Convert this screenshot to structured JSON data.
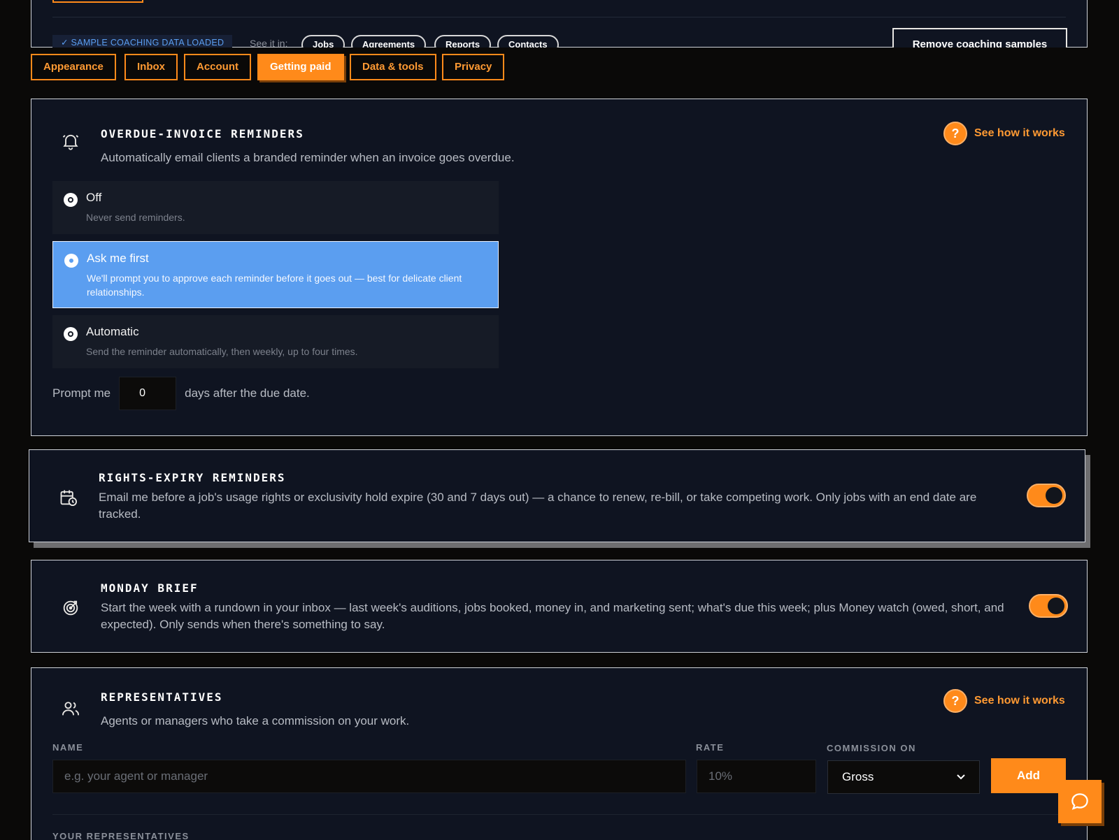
{
  "coaching": {
    "badge": "✓ SAMPLE COACHING DATA LOADED",
    "see_it_in": "See it in:",
    "links": [
      "Jobs",
      "Agreements",
      "Reports",
      "Contacts"
    ],
    "remove_label": "Remove coaching samples"
  },
  "tabs": [
    {
      "label": "Appearance",
      "active": false
    },
    {
      "label": "Inbox",
      "active": false
    },
    {
      "label": "Account",
      "active": false
    },
    {
      "label": "Getting paid",
      "active": true
    },
    {
      "label": "Data & tools",
      "active": false
    },
    {
      "label": "Privacy",
      "active": false
    }
  ],
  "overdue": {
    "icon": "bell-icon",
    "title": "OVERDUE-INVOICE REMINDERS",
    "description": "Automatically email clients a branded reminder when an invoice goes overdue.",
    "help": "See how it works",
    "options": [
      {
        "title": "Off",
        "desc": "Never send reminders.",
        "selected": false
      },
      {
        "title": "Ask me first",
        "desc": "We'll prompt you to approve each reminder before it goes out — best for delicate client relationships.",
        "selected": true
      },
      {
        "title": "Automatic",
        "desc": "Send the reminder automatically, then weekly, up to four times.",
        "selected": false
      }
    ],
    "prompt_prefix": "Prompt me",
    "prompt_days": "0",
    "prompt_suffix": "days after the due date."
  },
  "rights": {
    "icon": "calendar-clock-icon",
    "title": "RIGHTS-EXPIRY REMINDERS",
    "description": "Email me before a job's usage rights or exclusivity hold expire (30 and 7 days out) — a chance to renew, re-bill, or take competing work. Only jobs with an end date are tracked.",
    "enabled": true
  },
  "monday": {
    "icon": "target-icon",
    "title": "MONDAY BRIEF",
    "description": "Start the week with a rundown in your inbox — last week's auditions, jobs booked, money in, and marketing sent; what's due this week; plus Money watch (owed, short, and expected). Only sends when there's something to say.",
    "enabled": true
  },
  "reps": {
    "icon": "users-icon",
    "title": "REPRESENTATIVES",
    "description": "Agents or managers who take a commission on your work.",
    "help": "See how it works",
    "name_label": "NAME",
    "name_placeholder": "e.g. your agent or manager",
    "rate_label": "RATE",
    "rate_placeholder": "10%",
    "commission_label": "COMMISSION ON",
    "commission_value": "Gross",
    "add_label": "Add",
    "list_label": "YOUR REPRESENTATIVES"
  },
  "colors": {
    "accent": "#ff8a1a",
    "selected": "#5b9ef0",
    "card_bg": "#0f1421"
  },
  "chat_icon": "chat-bubble-icon"
}
